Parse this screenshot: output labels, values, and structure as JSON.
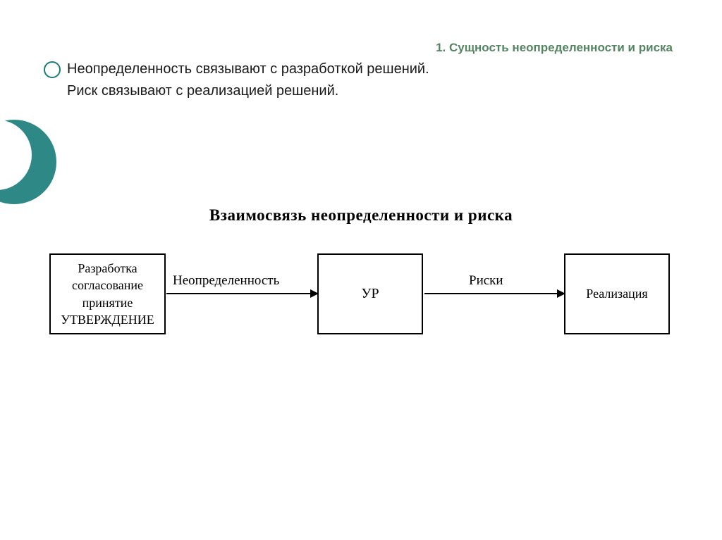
{
  "title": "1. Сущность неопределенности и риска",
  "body": {
    "line1": "Неопределенность связывают с разработкой решений.",
    "line2": "Риск связывают с реализацией решений."
  },
  "diagram": {
    "title": "Взаимосвязь неопределенности и риска",
    "box1": {
      "l1": "Разработка",
      "l2": "согласование",
      "l3": "принятие",
      "l4": "УТВЕРЖДЕНИЕ"
    },
    "edge1": "Неопределенность",
    "box2": "УР",
    "edge2": "Риски",
    "box3": "Реализация"
  },
  "colors": {
    "title": "#548462",
    "crescent": "#2e8986"
  }
}
